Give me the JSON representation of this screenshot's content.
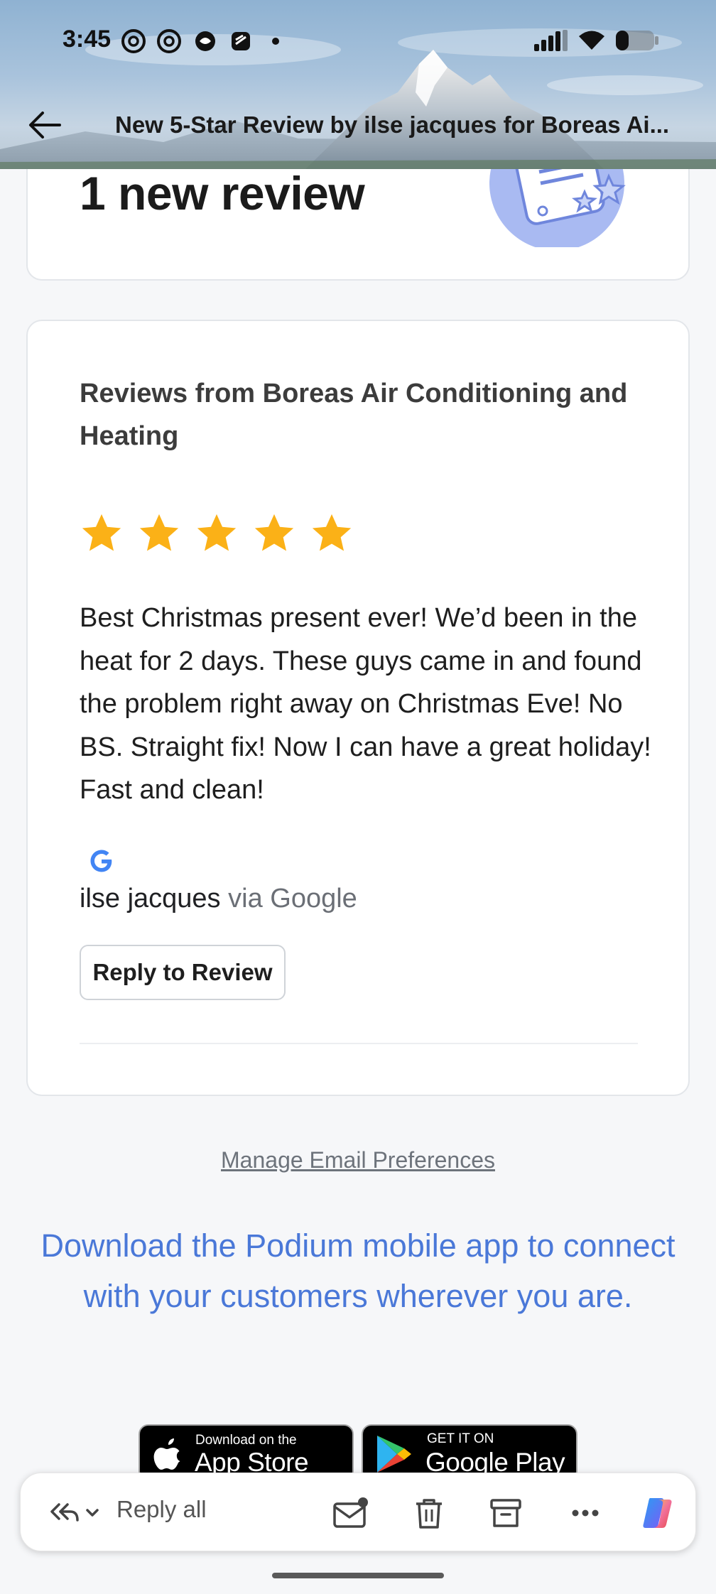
{
  "status_bar": {
    "time": "3:45"
  },
  "header": {
    "subject": "New 5-Star Review by ilse jacques for Boreas Ai..."
  },
  "summary_card": {
    "headline": "1 new review"
  },
  "review_card": {
    "business_heading": "Reviews from Boreas Air Conditioning and Heating",
    "rating": 5,
    "max_rating": 5,
    "review_text": "Best Christmas present ever! We’d been in the heat for 2 days. These guys came in and found the problem right away on Christmas Eve! No BS. Straight fix! Now I can have a great holiday! Fast and clean!",
    "reviewer_name": "ilse jacques",
    "source": "via Google",
    "reply_button": "Reply to Review"
  },
  "footer": {
    "manage_link": "Manage Email Preferences",
    "promo_text": "Download the Podium mobile app to connect with your customers wherever you are.",
    "app_store": {
      "small": "Download on the",
      "big": "App Store"
    },
    "google_play": {
      "small": "GET IT ON",
      "big": "Google Play"
    }
  },
  "action_bar": {
    "reply_all": "Reply all"
  },
  "colors": {
    "star": "#fbb117",
    "link_blue": "#4a78d8",
    "google_blue": "#4285f4"
  }
}
